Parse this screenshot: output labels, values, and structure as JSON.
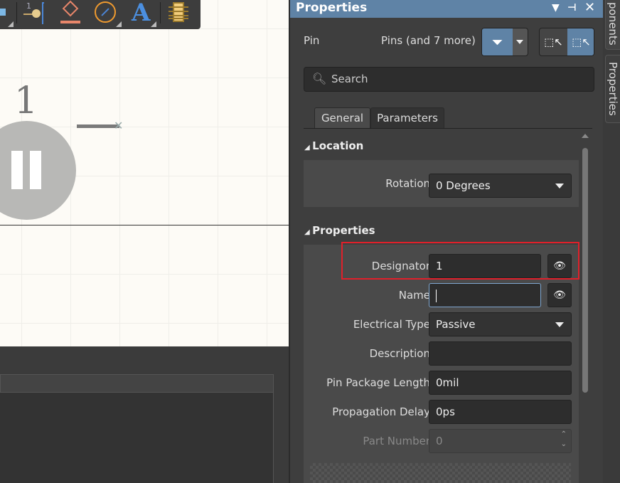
{
  "canvas": {
    "pin_designator": "1"
  },
  "toolbar": {
    "icons": [
      "bus-icon",
      "pin-icon",
      "port-icon",
      "arc-icon",
      "text-icon",
      "component-icon"
    ]
  },
  "panel": {
    "title": "Properties",
    "header_icons": [
      "dropdown-icon",
      "pin-icon",
      "close-icon"
    ],
    "object_type": "Pin",
    "selection": "Pins (and 7 more)",
    "search_placeholder": "Search",
    "tabs": [
      "General",
      "Parameters"
    ],
    "active_tab": "General",
    "location": {
      "title": "Location",
      "rotation_label": "Rotation",
      "rotation_value": "0 Degrees"
    },
    "properties": {
      "title": "Properties",
      "designator_label": "Designator",
      "designator_value": "1",
      "name_label": "Name",
      "name_value": "",
      "electrical_type_label": "Electrical Type",
      "electrical_type_value": "Passive",
      "description_label": "Description",
      "description_value": "",
      "pin_package_length_label": "Pin Package Length",
      "pin_package_length_value": "0mil",
      "propagation_delay_label": "Propagation Delay",
      "propagation_delay_value": "0ps",
      "part_number_label": "Part Number",
      "part_number_value": "0"
    },
    "highlight_color": "#e0202a",
    "accent_color": "#5f83a6"
  },
  "side_tabs": [
    "ponents",
    "Properties"
  ]
}
